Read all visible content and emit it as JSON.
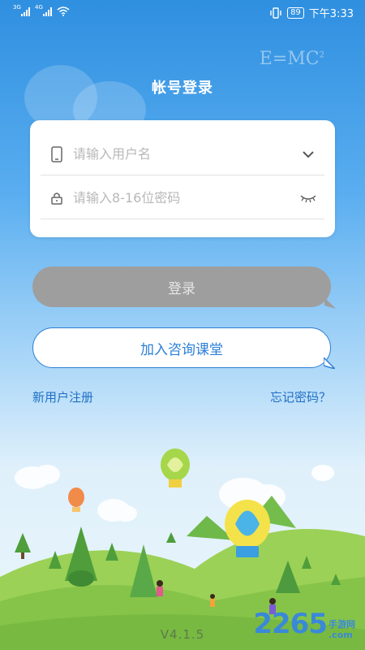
{
  "status": {
    "net1": "3G",
    "net2": "4G",
    "battery": "89",
    "time": "下午3:33"
  },
  "decor_text": "E=MC",
  "decor_sup": "2",
  "title": "帐号登录",
  "form": {
    "username_placeholder": "请输入用户名",
    "password_placeholder": "请输入8-16位密码"
  },
  "buttons": {
    "login": "登录",
    "join": "加入咨询课堂"
  },
  "links": {
    "register": "新用户注册",
    "forgot": "忘记密码？"
  },
  "version": "V4.1.5",
  "watermark": {
    "brand": "2265",
    "suffix": "手游网",
    "domain": ".com"
  },
  "colors": {
    "accent": "#2b7fd6",
    "login_button": "#9e9e9e",
    "sky_top": "#2f8fe0",
    "grass": "#8cc84b"
  },
  "icons": [
    "phone-icon",
    "chevron-down-icon",
    "lock-icon",
    "eye-closed-icon",
    "wifi-icon",
    "vibrate-icon"
  ]
}
